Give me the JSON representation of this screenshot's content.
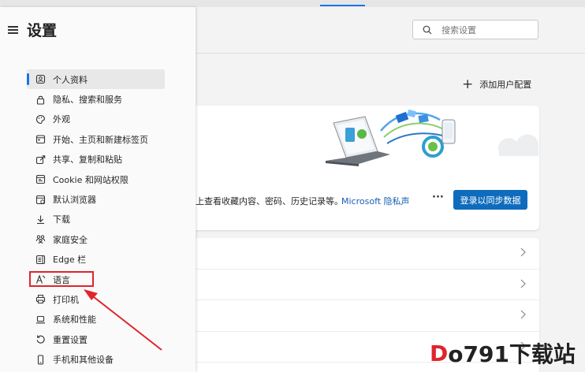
{
  "header": {
    "title": "设置"
  },
  "search": {
    "placeholder": "搜索设置"
  },
  "nav": {
    "items": [
      {
        "label": "个人资料",
        "icon": "profile-icon",
        "active": true
      },
      {
        "label": "隐私、搜索和服务",
        "icon": "lock-icon"
      },
      {
        "label": "外观",
        "icon": "palette-icon"
      },
      {
        "label": "开始、主页和新建标签页",
        "icon": "home-tabs-icon"
      },
      {
        "label": "共享、复制和粘贴",
        "icon": "share-icon"
      },
      {
        "label": "Cookie 和网站权限",
        "icon": "cookie-icon"
      },
      {
        "label": "默认浏览器",
        "icon": "browser-icon"
      },
      {
        "label": "下载",
        "icon": "download-icon"
      },
      {
        "label": "家庭安全",
        "icon": "family-icon"
      },
      {
        "label": "Edge 栏",
        "icon": "edge-bar-icon"
      },
      {
        "label": "语言",
        "icon": "language-icon"
      },
      {
        "label": "打印机",
        "icon": "printer-icon"
      },
      {
        "label": "系统和性能",
        "icon": "laptop-icon"
      },
      {
        "label": "重置设置",
        "icon": "reset-icon"
      },
      {
        "label": "手机和其他设备",
        "icon": "phone-icon"
      }
    ]
  },
  "main": {
    "add_profile_label": "添加用户配置",
    "sync_text": "上查看收藏内容、密码、历史记录等。",
    "sync_link": "Microsoft 隐私声",
    "more_label": "···",
    "sync_button": "登录以同步数据"
  },
  "watermark": {
    "red_part": "D",
    "text": "o791下载站"
  },
  "colors": {
    "accent": "#0f6cbd",
    "highlight": "#e0242c"
  }
}
